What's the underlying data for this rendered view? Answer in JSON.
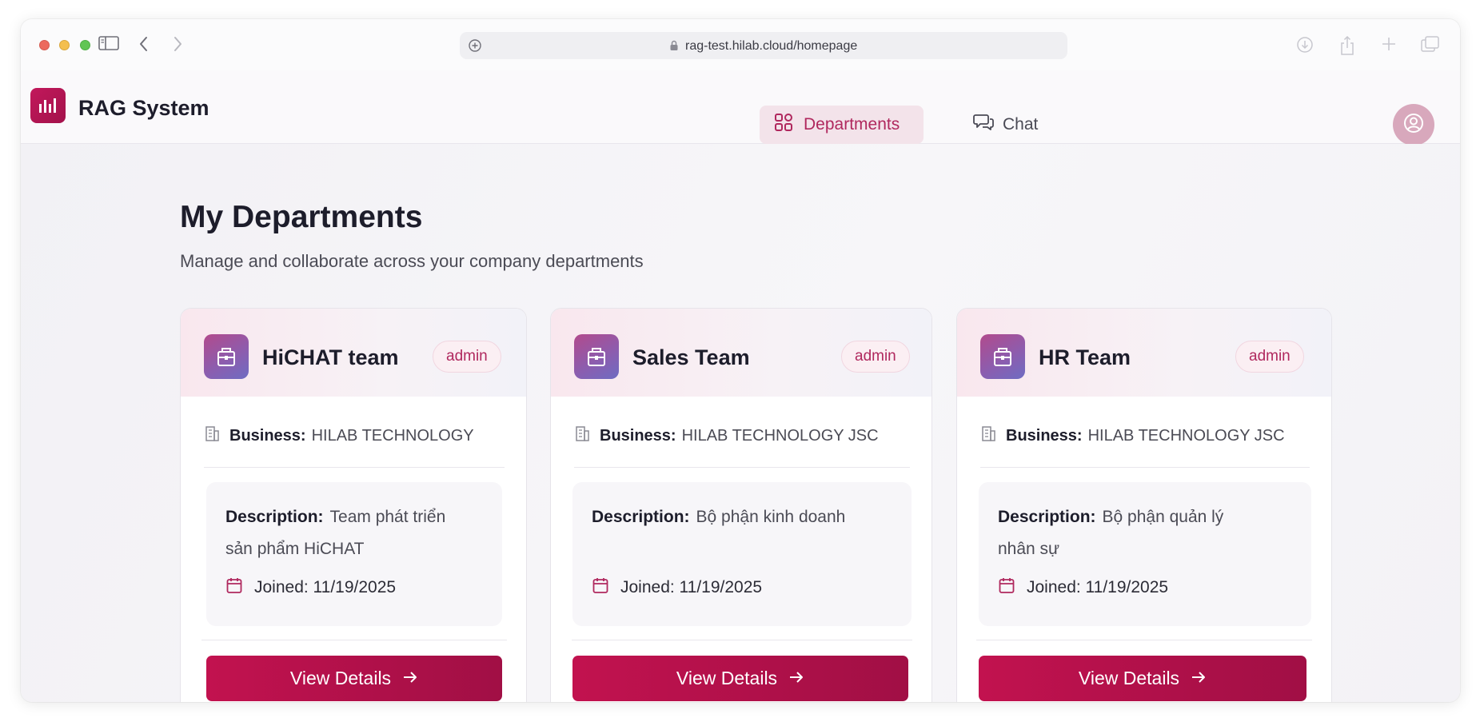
{
  "browser": {
    "url": "rag-test.hilab.cloud/homepage"
  },
  "app": {
    "brand": "RAG System",
    "nav": {
      "departments_label": "Departments",
      "chat_label": "Chat"
    }
  },
  "page": {
    "title": "My Departments",
    "subtitle": "Manage and collaborate across your company departments"
  },
  "departments": [
    {
      "name": "HiCHAT team",
      "role": "admin",
      "business_label": "Business:",
      "business": "HILAB TECHNOLOGY",
      "description_label": "Description:",
      "description_line1": "Team phát triển",
      "description_line2": "sản phẩm HiCHAT",
      "joined": "Joined: 11/19/2025",
      "button": "View Details"
    },
    {
      "name": "Sales Team",
      "role": "admin",
      "business_label": "Business:",
      "business": "HILAB TECHNOLOGY JSC",
      "description_label": "Description:",
      "description_line1": "Bộ phận kinh doanh",
      "description_line2": "",
      "joined": "Joined: 11/19/2025",
      "button": "View Details"
    },
    {
      "name": "HR Team",
      "role": "admin",
      "business_label": "Business:",
      "business": "HILAB TECHNOLOGY JSC",
      "description_label": "Description:",
      "description_line1": "Bộ phận quản lý",
      "description_line2": "nhân sự",
      "joined": "Joined: 11/19/2025",
      "button": "View Details"
    }
  ],
  "colors": {
    "accent": "#b0285e",
    "button": "#c2124f",
    "avatar": "#d8a8bc"
  }
}
